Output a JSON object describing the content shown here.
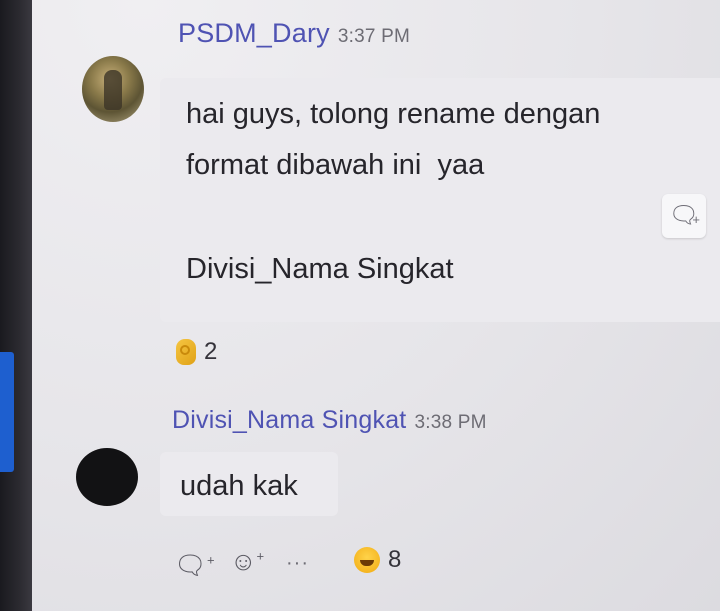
{
  "messages": [
    {
      "sender": "PSDM_Dary",
      "time": "3:37 PM",
      "lines": [
        "hai guys, tolong rename dengan",
        "format dibawah ini  yaa",
        "",
        "Divisi_Nama Singkat"
      ],
      "reaction": {
        "icon": "ok-hand-icon",
        "count": "2"
      }
    },
    {
      "sender": "Divisi_Nama Singkat",
      "time": "3:38 PM",
      "lines": [
        "udah kak"
      ],
      "reaction": {
        "icon": "laughing-emoji-icon",
        "count": "8"
      }
    }
  ],
  "actions": {
    "reply_icon": "reply-icon",
    "emoji_icon": "add-reaction-icon",
    "more_icon": "more-options-icon",
    "side_reply_icon": "reply-icon",
    "more_label": "···"
  },
  "colors": {
    "sender": "#4f53b3",
    "accent_tab": "#1e5fcf",
    "bubble": "#ebeaee"
  }
}
